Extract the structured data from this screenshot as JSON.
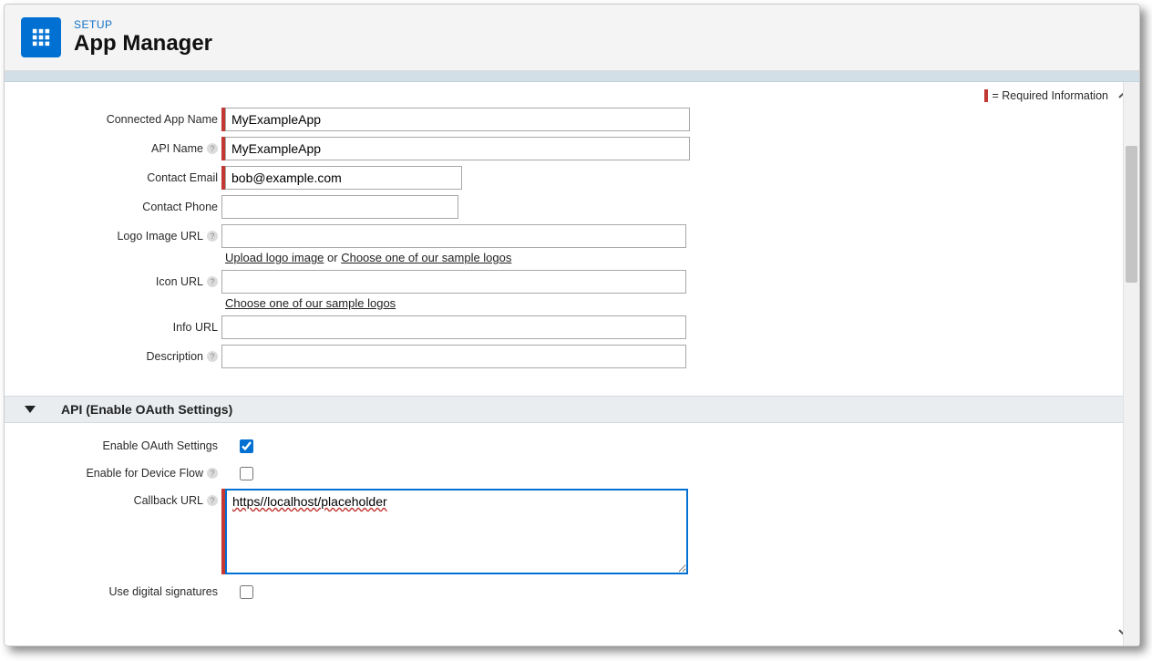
{
  "header": {
    "eyebrow": "SETUP",
    "title": "App Manager"
  },
  "requiredLegend": "= Required Information",
  "form": {
    "rows": {
      "connectedAppName": {
        "label": "Connected App Name",
        "value": "MyExampleApp",
        "required": true,
        "width": "wide"
      },
      "apiName": {
        "label": "API Name",
        "value": "MyExampleApp",
        "required": true,
        "width": "wide",
        "help": true
      },
      "contactEmail": {
        "label": "Contact Email",
        "value": "bob@example.com",
        "required": true,
        "width": "med"
      },
      "contactPhone": {
        "label": "Contact Phone",
        "value": "",
        "width": "med"
      },
      "logoImageUrl": {
        "label": "Logo Image URL",
        "value": "",
        "width": "wide",
        "help": true,
        "hintPrefix": "Upload logo image",
        "hintMid": " or ",
        "hintSuffix": "Choose one of our sample logos"
      },
      "iconUrl": {
        "label": "Icon URL",
        "value": "",
        "width": "wide",
        "help": true,
        "hint": "Choose one of our sample logos"
      },
      "infoUrl": {
        "label": "Info URL",
        "value": "",
        "width": "wide"
      },
      "description": {
        "label": "Description",
        "value": "",
        "width": "wide",
        "help": true
      }
    }
  },
  "section": {
    "title": "API (Enable OAuth Settings)"
  },
  "oauth": {
    "enableSettings": {
      "label": "Enable OAuth Settings",
      "checked": true
    },
    "enableDeviceFlow": {
      "label": "Enable for Device Flow",
      "checked": false,
      "help": true
    },
    "callbackUrl": {
      "label": "Callback URL",
      "value": "https//localhost/placeholder",
      "required": true,
      "help": true
    },
    "useDigitalSignatures": {
      "label": "Use digital signatures",
      "checked": false
    }
  }
}
